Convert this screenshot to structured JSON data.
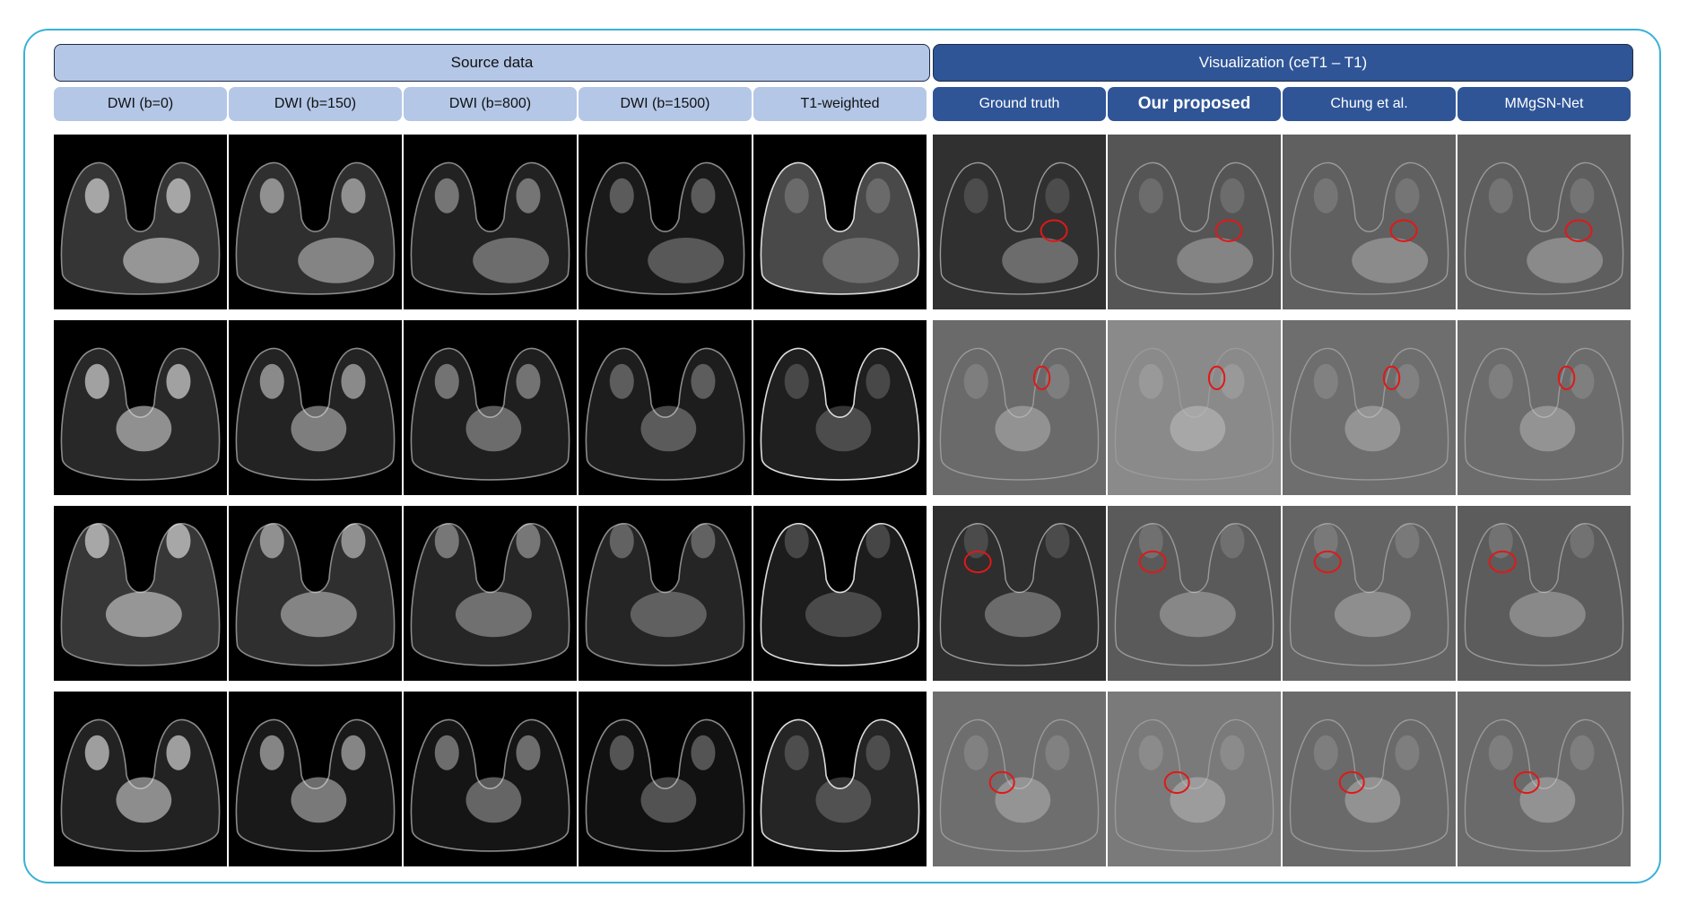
{
  "banners": {
    "source": "Source data",
    "visualization": "Visualization (ceT1 – T1)"
  },
  "columns": [
    {
      "label": "DWI (b=0)",
      "group": "source",
      "emphasis": false
    },
    {
      "label": "DWI (b=150)",
      "group": "source",
      "emphasis": false
    },
    {
      "label": "DWI (b=800)",
      "group": "source",
      "emphasis": false
    },
    {
      "label": "DWI (b=1500)",
      "group": "source",
      "emphasis": false
    },
    {
      "label": "T1-weighted",
      "group": "source",
      "emphasis": false
    },
    {
      "label": "Ground truth",
      "group": "visualization",
      "emphasis": false
    },
    {
      "label": "Our proposed",
      "group": "visualization",
      "emphasis": true
    },
    {
      "label": "Chung et al.",
      "group": "visualization",
      "emphasis": false
    },
    {
      "label": "MMgSN-Net",
      "group": "visualization",
      "emphasis": false
    }
  ],
  "rows": 4,
  "colors": {
    "frame": "#3ab1d8",
    "source_header": "#b4c7e7",
    "visualization_header": "#2f5597",
    "lesion_marker": "#e01818"
  },
  "markers": "red ellipses mark the lesion in every visualization panel"
}
